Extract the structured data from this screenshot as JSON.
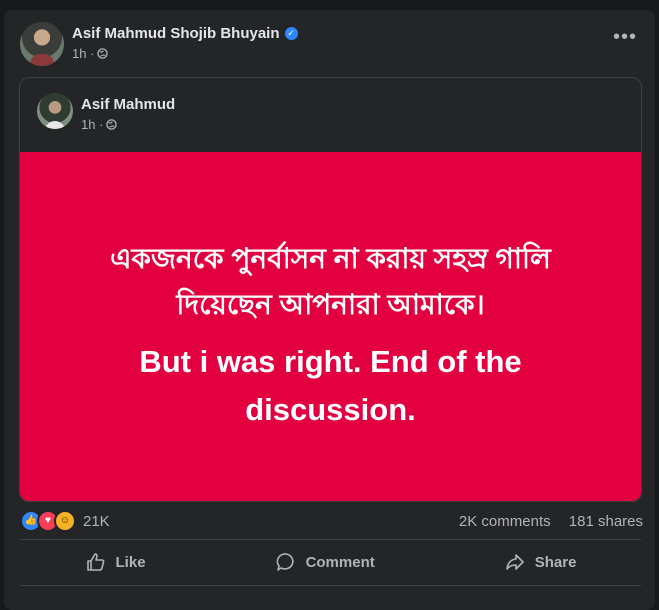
{
  "post": {
    "author": "Asif Mahmud Shojib Bhuyain",
    "time": "1h ·",
    "more": "•••",
    "verified_mark": "✓"
  },
  "shared_post": {
    "author": "Asif Mahmud",
    "time": "1h ·",
    "bengali_line_1": "একজনকে পুনর্বাসন না করায় সহস্র গালি",
    "bengali_line_2": "দিয়েছেন আপনারা আমাকে।",
    "english_line_1": "But i was right. End of the",
    "english_line_2": "discussion.",
    "background_color": "#e20041"
  },
  "stats": {
    "reactions_count": "21K",
    "comments": "2K comments",
    "shares": "181 shares",
    "reaction_icons": [
      "like-icon",
      "love-icon",
      "haha-icon"
    ]
  },
  "actions": {
    "like": "Like",
    "comment": "Comment",
    "share": "Share"
  }
}
